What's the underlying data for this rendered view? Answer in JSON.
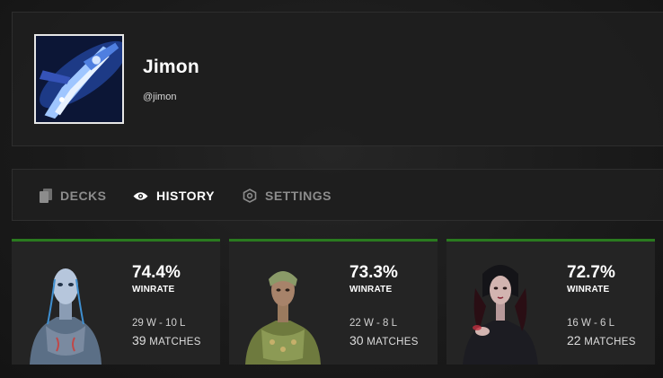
{
  "profile": {
    "name": "Jimon",
    "handle": "@jimon"
  },
  "tabs": [
    {
      "label": "DECKS",
      "icon": "deck-cards-icon",
      "active": false
    },
    {
      "label": "HISTORY",
      "icon": "eye-icon",
      "active": true
    },
    {
      "label": "SETTINGS",
      "icon": "hexagon-gear-icon",
      "active": false
    }
  ],
  "cards": [
    {
      "winrate": "74.4%",
      "winrate_label": "WINRATE",
      "record": "29 W - 10 L",
      "matches": "39",
      "matches_label": "MATCHES",
      "portrait": "pale-blue-humanoid-portrait"
    },
    {
      "winrate": "73.3%",
      "winrate_label": "WINRATE",
      "record": "22 W - 8 L",
      "matches": "30",
      "matches_label": "MATCHES",
      "portrait": "green-armored-woman-portrait"
    },
    {
      "winrate": "72.7%",
      "winrate_label": "WINRATE",
      "record": "16 W - 6 L",
      "matches": "22",
      "matches_label": "MATCHES",
      "portrait": "dark-hooded-woman-portrait"
    }
  ],
  "colors": {
    "accent_green": "#2a7a1f",
    "tab_inactive": "#8c8c8c",
    "tab_active": "#ffffff"
  }
}
